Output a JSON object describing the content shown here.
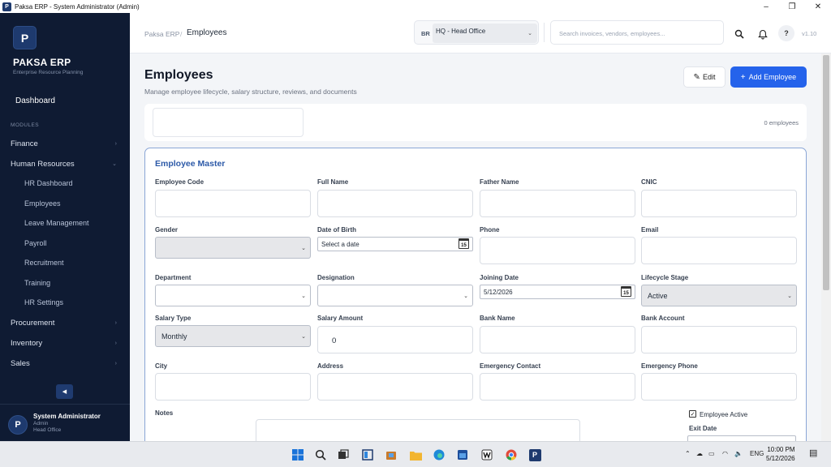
{
  "window": {
    "title": "Paksa ERP - System Administrator (Admin)",
    "min": "–",
    "max": "❐",
    "close": "✕",
    "app_icon": "P"
  },
  "sidebar": {
    "logo": "P",
    "brand": "PAKSA ERP",
    "tagline": "Enterprise Resource Planning",
    "dashboard": "Dashboard",
    "modules_label": "MODULES",
    "nav": [
      {
        "label": "Finance",
        "chev": "›"
      },
      {
        "label": "Human Resources",
        "chev": "⌄"
      },
      {
        "label": "Procurement",
        "chev": "›"
      },
      {
        "label": "Inventory",
        "chev": "›"
      },
      {
        "label": "Sales",
        "chev": "›"
      }
    ],
    "hr_items": [
      "HR Dashboard",
      "Employees",
      "Leave Management",
      "Payroll",
      "Recruitment",
      "Training",
      "HR Settings"
    ],
    "collapse": "◀",
    "user": {
      "initial": "P",
      "name": "System Administrator",
      "role": "Admin",
      "location": "Head Office"
    }
  },
  "topbar": {
    "crumb_root": "Paksa ERP",
    "crumb_sep": "/",
    "crumb_current": "Employees",
    "branch_code": "BR",
    "branch_value": "HQ - Head Office",
    "search_placeholder": "Search invoices, vendors, employees...",
    "help": "?",
    "version": "v1.10"
  },
  "page": {
    "title": "Employees",
    "subtitle": "Manage employee lifecycle, salary structure, reviews, and documents",
    "edit_label": "Edit",
    "add_label": "Add Employee",
    "employee_count": "0 employees"
  },
  "form": {
    "title": "Employee Master",
    "labels": {
      "employee_code": "Employee Code",
      "full_name": "Full Name",
      "father_name": "Father Name",
      "cnic": "CNIC",
      "gender": "Gender",
      "dob": "Date of Birth",
      "phone": "Phone",
      "email": "Email",
      "department": "Department",
      "designation": "Designation",
      "joining_date": "Joining Date",
      "lifecycle": "Lifecycle Stage",
      "salary_type": "Salary Type",
      "salary_amount": "Salary Amount",
      "bank_name": "Bank Name",
      "bank_account": "Bank Account",
      "city": "City",
      "address": "Address",
      "emergency_contact": "Emergency Contact",
      "emergency_phone": "Emergency Phone",
      "notes": "Notes",
      "employee_active": "Employee Active",
      "exit_date": "Exit Date"
    },
    "values": {
      "dob_placeholder": "Select a date",
      "joining_date": "5/12/2026",
      "lifecycle": "Active",
      "salary_type": "Monthly",
      "salary_amount": "0",
      "employee_active_check": "✓",
      "cal_day": "15"
    }
  },
  "taskbar": {
    "lang": "ENG",
    "time": "10:00 PM",
    "date": "5/12/2026"
  }
}
